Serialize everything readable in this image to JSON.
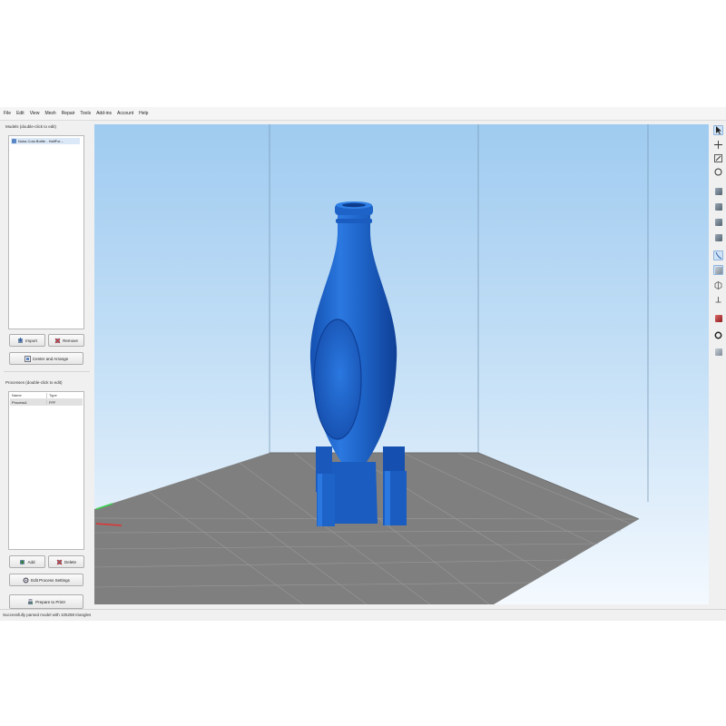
{
  "menu": [
    "File",
    "Edit",
    "View",
    "Mesh",
    "Repair",
    "Tools",
    "Add-ins",
    "Account",
    "Help"
  ],
  "models_panel": {
    "title": "Models (double-click to edit)",
    "items": [
      {
        "label": "Nuka Cola Bottle - HalfFor..."
      }
    ],
    "import_label": "Import",
    "remove_label": "Remove",
    "center_label": "Center and Arrange"
  },
  "processes_panel": {
    "title": "Processes (double-click to edit)",
    "columns": [
      "Name",
      "Type"
    ],
    "rows": [
      {
        "name": "Process1",
        "type": "FFF"
      }
    ],
    "add_label": "Add",
    "delete_label": "Delete",
    "edit_label": "Edit Process Settings",
    "prepare_label": "Prepare to Print!"
  },
  "viewport": {
    "object": "bottle",
    "object_color": "#1e64c8",
    "bed_color": "#7f7f7f",
    "sky_top": "#9fcbf0"
  },
  "toolbar_icons": [
    "select-icon",
    "move-icon",
    "scale-icon",
    "rotate-icon",
    "view-iso-icon",
    "view-front-icon",
    "view-top-icon",
    "view-side-icon",
    "cut-icon",
    "view-shaded-icon",
    "view-wireframe-icon",
    "pin-icon",
    "toggle-icon",
    "support-icon",
    "settings-icon"
  ],
  "status": "Successfully parsed model with 105288 triangles"
}
